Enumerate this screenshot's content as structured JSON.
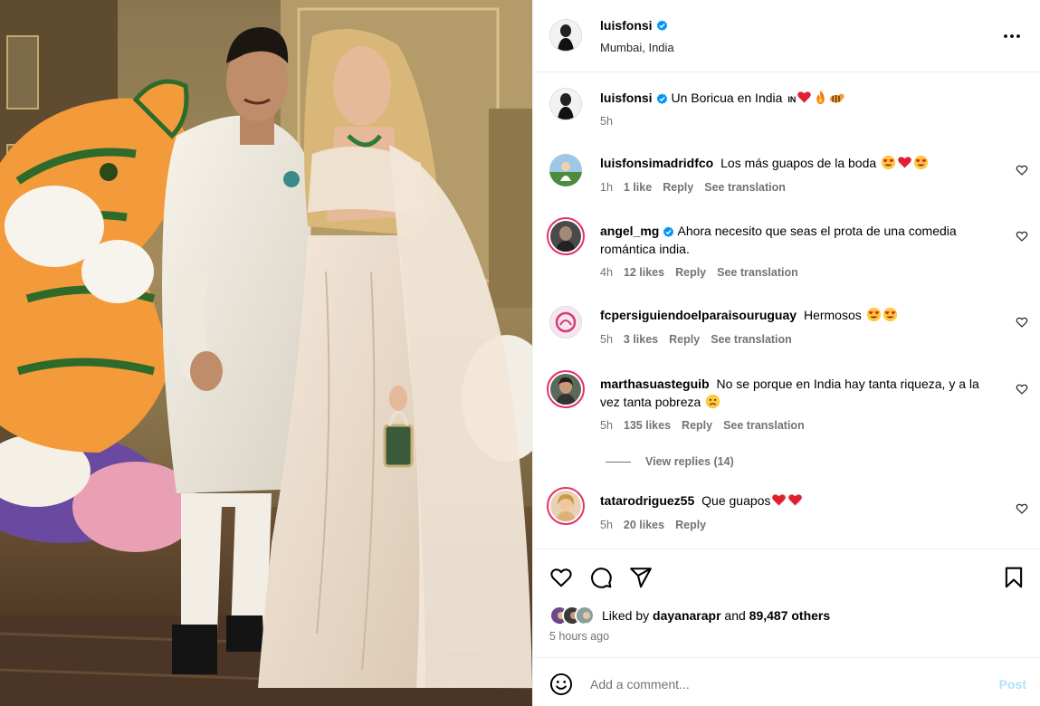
{
  "header": {
    "username": "luisfonsi",
    "location": "Mumbai, India",
    "more_icon": "more-horizontal-icon"
  },
  "caption": {
    "username": "luisfonsi",
    "text": "Un Boricua en India",
    "flag_text": "IN",
    "emojis": [
      "red-heart",
      "fire",
      "tiger"
    ],
    "time": "5h"
  },
  "comments": [
    {
      "username": "luisfonsimadridfco",
      "text": "Los más guapos de la boda",
      "emojis": [
        "heart-eyes",
        "red-heart",
        "heart-eyes"
      ],
      "time": "1h",
      "likes": "1 like",
      "reply": "Reply",
      "translate": "See translation"
    },
    {
      "username": "angel_mg",
      "verified": true,
      "text": "Ahora necesito que seas el prota de una comedia romántica india.",
      "time": "4h",
      "likes": "12 likes",
      "reply": "Reply",
      "translate": "See translation"
    },
    {
      "username": "fcpersiguiendoelparaisouruguay",
      "text": "Hermosos",
      "emojis": [
        "heart-eyes",
        "heart-eyes"
      ],
      "time": "5h",
      "likes": "3 likes",
      "reply": "Reply",
      "translate": "See translation"
    },
    {
      "username": "marthasuasteguib",
      "text": "No se porque en India hay tanta riqueza, y a la vez tanta pobreza",
      "emojis": [
        "sad-face"
      ],
      "time": "5h",
      "likes": "135 likes",
      "reply": "Reply",
      "translate": "See translation",
      "view_replies": "View replies (14)"
    },
    {
      "username": "tatarodriguez55",
      "text": "Que guapos",
      "emojis": [
        "red-heart",
        "red-heart"
      ],
      "time": "5h",
      "likes": "20 likes",
      "reply": "Reply"
    }
  ],
  "actions": {
    "icons": [
      "heart-icon",
      "comment-icon",
      "share-icon",
      "bookmark-icon"
    ],
    "liked_by_prefix": "Liked by",
    "liked_by_user": "dayanarapr",
    "liked_by_and": "and",
    "liked_by_others": "89,487 others",
    "time_ago": "5 hours ago"
  },
  "add_comment": {
    "placeholder": "Add a comment...",
    "post_label": "Post"
  },
  "colors": {
    "verified": "#0095f6",
    "muted": "#737373",
    "border": "#efefef",
    "post_disabled": "#b2dffc",
    "story_ring": "#e1306c"
  }
}
